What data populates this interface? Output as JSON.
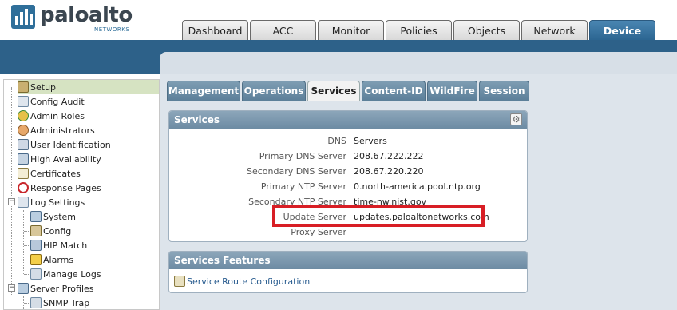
{
  "brand": {
    "name": "paloalto",
    "tagline": "NETWORKS"
  },
  "main_tabs": [
    {
      "label": "Dashboard",
      "active": false
    },
    {
      "label": "ACC",
      "active": false
    },
    {
      "label": "Monitor",
      "active": false
    },
    {
      "label": "Policies",
      "active": false
    },
    {
      "label": "Objects",
      "active": false
    },
    {
      "label": "Network",
      "active": false
    },
    {
      "label": "Device",
      "active": true
    }
  ],
  "sidebar": {
    "items": [
      {
        "label": "Setup",
        "icon": "gear-icon",
        "selected": true
      },
      {
        "label": "Config Audit",
        "icon": "document-icon"
      },
      {
        "label": "Admin Roles",
        "icon": "roles-icon"
      },
      {
        "label": "Administrators",
        "icon": "users-icon"
      },
      {
        "label": "User Identification",
        "icon": "user-id-icon"
      },
      {
        "label": "High Availability",
        "icon": "ha-icon"
      },
      {
        "label": "Certificates",
        "icon": "certificate-icon"
      },
      {
        "label": "Response Pages",
        "icon": "no-entry-icon"
      },
      {
        "label": "Log Settings",
        "icon": "log-icon",
        "expandable": true
      },
      {
        "label": "System",
        "icon": "system-log-icon"
      },
      {
        "label": "Config",
        "icon": "config-log-icon"
      },
      {
        "label": "HIP Match",
        "icon": "hip-icon"
      },
      {
        "label": "Alarms",
        "icon": "alarm-icon"
      },
      {
        "label": "Manage Logs",
        "icon": "manage-logs-icon"
      },
      {
        "label": "Server Profiles",
        "icon": "server-icon",
        "expandable": true
      },
      {
        "label": "SNMP Trap",
        "icon": "snmp-icon"
      }
    ]
  },
  "sub_tabs": [
    {
      "label": "Management",
      "active": false
    },
    {
      "label": "Operations",
      "active": false
    },
    {
      "label": "Services",
      "active": true
    },
    {
      "label": "Content-ID",
      "active": false
    },
    {
      "label": "WildFire",
      "active": false
    },
    {
      "label": "Session",
      "active": false
    }
  ],
  "services_panel": {
    "title": "Services",
    "rows": [
      {
        "label": "DNS",
        "value": "Servers"
      },
      {
        "label": "Primary DNS Server",
        "value": "208.67.222.222"
      },
      {
        "label": "Secondary DNS Server",
        "value": "208.67.220.220"
      },
      {
        "label": "Primary NTP Server",
        "value": "0.north-america.pool.ntp.org"
      },
      {
        "label": "Secondary NTP Server",
        "value": "time-nw.nist.gov"
      },
      {
        "label": "Update Server",
        "value": "updates.paloaltonetworks.com"
      },
      {
        "label": "Proxy Server",
        "value": ""
      }
    ]
  },
  "features_panel": {
    "title": "Services Features",
    "link": "Service Route Configuration"
  },
  "colors": {
    "brand_blue": "#2d6189",
    "highlight_red": "#d81e25",
    "selected_bg": "#d6e3c2"
  }
}
